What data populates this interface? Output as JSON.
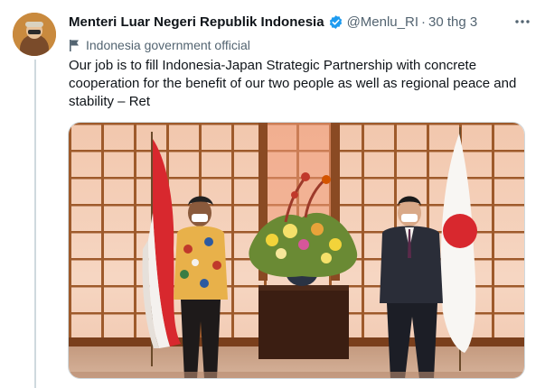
{
  "tweet": {
    "author_name": "Menteri Luar Negeri Republik Indonesia",
    "handle": "@Menlu_RI",
    "separator": "·",
    "time": "30 thg 3",
    "label": "Indonesia government official",
    "text": "Our job is to fill Indonesia-Japan Strategic Partnership with concrete cooperation for the benefit of our two people as well as regional peace and stability – Ret"
  },
  "icons": {
    "verified": "verified-badge-icon",
    "more": "more-options-icon",
    "label": "flag-icon"
  },
  "colors": {
    "accent": "#1d9bf0",
    "text": "#0f1419",
    "secondary": "#536471"
  }
}
